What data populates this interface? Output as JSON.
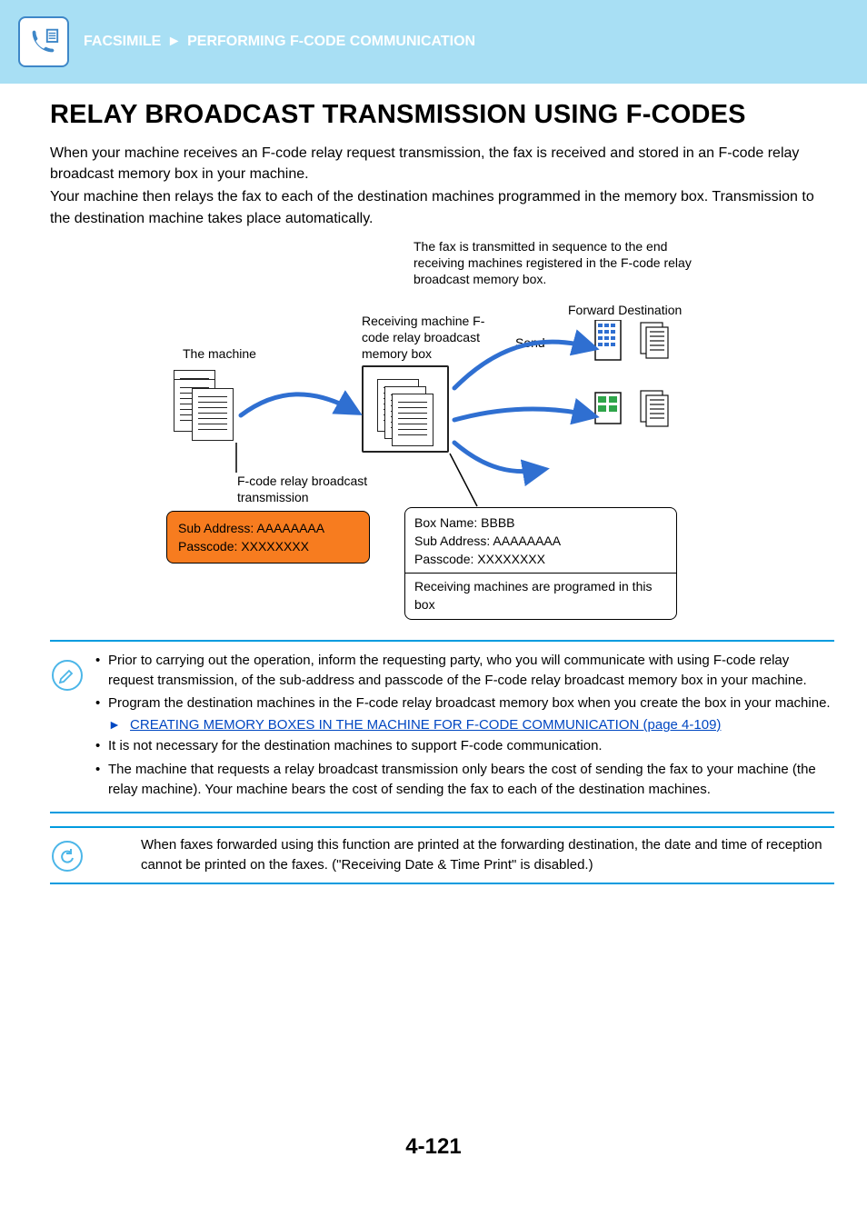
{
  "header": {
    "crumb1": "FACSIMILE",
    "arrow": "►",
    "crumb2": "PERFORMING F-CODE COMMUNICATION"
  },
  "title": "RELAY BROADCAST TRANSMISSION USING F-CODES",
  "intro": {
    "p1": "When your machine receives an F-code relay request transmission, the fax is received and stored in an F-code relay broadcast memory box in your machine.",
    "p2": "Your machine then relays the fax to each of the destination machines programmed in the memory box. Transmission to the destination machine takes place automatically."
  },
  "diagram": {
    "caption": "The fax is transmitted in sequence to the end receiving machines registered in the F-code relay broadcast memory box.",
    "the_machine": "The machine",
    "recv_label": "Receiving machine F-code relay broadcast memory box",
    "send": "Send",
    "forward_dest": "Forward Destination",
    "relay_label": "F-code relay broadcast transmission",
    "orange_sub": "Sub Address: AAAAAAAA",
    "orange_pass": "Passcode: XXXXXXXX",
    "box_name": "Box Name: BBBB",
    "box_sub": "Sub Address: AAAAAAAA",
    "box_pass": "Passcode: XXXXXXXX",
    "box_note": "Receiving machines are programed in this box"
  },
  "notes1": {
    "b1": "Prior to carrying out the operation, inform the requesting party, who you will communicate with using F-code relay request transmission, of the sub-address and passcode of the F-code relay broadcast memory box in your machine.",
    "b2": "Program the destination machines in the F-code relay broadcast memory box when you create the box in your machine.",
    "link_arrow": "►",
    "link_text": "CREATING MEMORY BOXES IN THE MACHINE FOR F-CODE COMMUNICATION (page 4-109)",
    "b3": "It is not necessary for the destination machines to support F-code communication.",
    "b4": "The machine that requests a relay broadcast transmission only bears the cost of sending the fax to your machine (the relay machine). Your machine bears the cost of sending the fax to each of the destination machines."
  },
  "notes2": {
    "body": "When faxes forwarded using this function are printed at the forwarding destination, the date and time of reception cannot be printed on the faxes. (\"Receiving Date & Time Print\" is disabled.)"
  },
  "page_number": "4-121"
}
